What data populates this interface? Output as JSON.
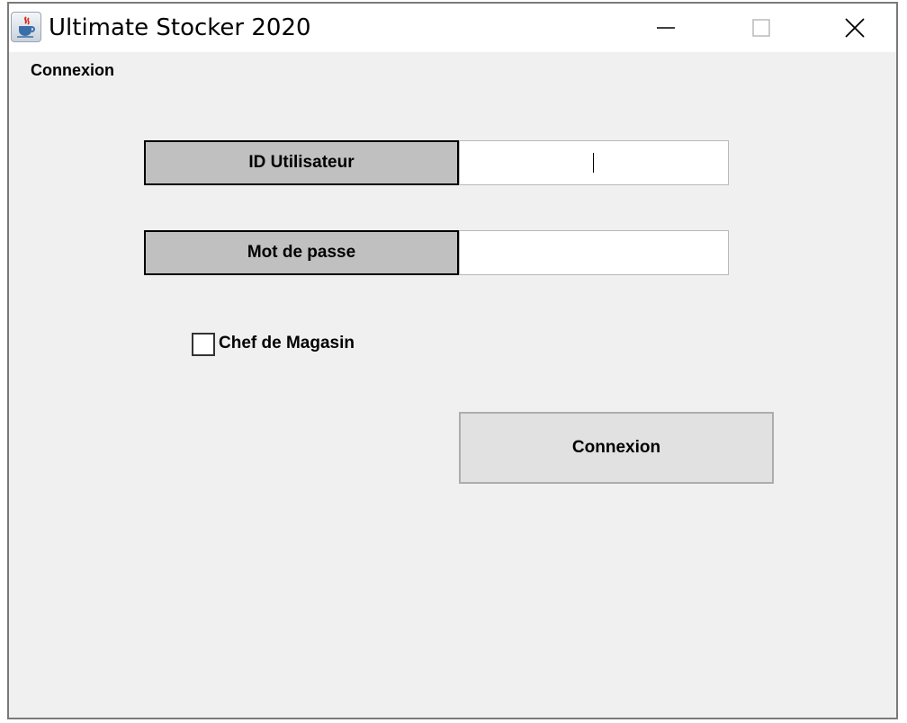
{
  "window": {
    "title": "Ultimate Stocker 2020",
    "icon": "java-coffee-cup-icon",
    "controls": [
      "minimize-icon",
      "maximize-icon",
      "close-icon"
    ]
  },
  "form": {
    "section_label": "Connexion",
    "user_id_label": "ID Utilisateur",
    "user_id_value": "",
    "password_label": "Mot de passe",
    "password_value": "",
    "manager_checkbox_label": "Chef de Magasin",
    "manager_checked": false,
    "submit_label": "Connexion"
  },
  "colors": {
    "window_bg": "#f0f0f0",
    "label_bg": "#c0c0c0",
    "button_bg": "#e1e1e1",
    "titlebar_bg": "#ffffff"
  }
}
